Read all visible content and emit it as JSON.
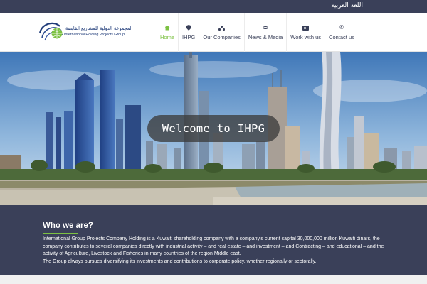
{
  "topbar": {
    "language_link": "اللغة العربية"
  },
  "logo": {
    "name_ar": "المجموعة الدولية للمشاريع القابضة",
    "name_en": "International Holding Projects Group"
  },
  "nav": {
    "items": [
      {
        "label": "Home",
        "icon": "home-icon",
        "active": true
      },
      {
        "label": "IHPG",
        "icon": "shield-icon",
        "active": false
      },
      {
        "label": "Our Companies",
        "icon": "sitemap-icon",
        "active": false
      },
      {
        "label": "News & Media",
        "icon": "eye-icon",
        "active": false
      },
      {
        "label": "Work with us",
        "icon": "id-card-icon",
        "active": false
      },
      {
        "label": "Contact us",
        "icon": "phone-icon",
        "active": false
      }
    ]
  },
  "hero": {
    "welcome": "Welcome to IHPG"
  },
  "about": {
    "title": "Who we are?",
    "paragraph1": "International Group Projects Company Holding is a Kuwaiti shareholding company with a company's current capital 30,000,000 million Kuwaiti dinars, the company contributes to several companies directly with industrial activity – and real estate – and investment – and Contracting – and educational – and the activity of Agriculture, Livestock and Fisheries in many countries of the region Middle east.",
    "paragraph2": "The Group always pursues diversifying its investments and contributions to corporate policy, whether regionally or sectorally."
  },
  "colors": {
    "primary": "#3a4059",
    "accent": "#7cc142"
  }
}
